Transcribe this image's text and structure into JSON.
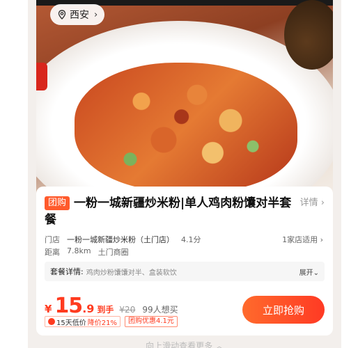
{
  "location": {
    "city": "西安",
    "pin_icon": "location-pin-icon",
    "chevron_icon": "chevron-right-icon"
  },
  "deal": {
    "tag": "团购",
    "title": "一粉一城新疆炒米粉|单人鸡肉粉馕对半套餐",
    "detail_link": "详情 ›",
    "store_label": "门店",
    "store_name": "一粉一城新疆炒米粉（土门店）",
    "rating": "4.1分",
    "stores_applicable": "1家店适用 ›",
    "distance_label": "距离",
    "distance": "7.8km",
    "area": "土门商圈",
    "package_label": "套餐详情:",
    "package_value": "鸡肉炒粉馕馕对半、盒装软饮",
    "expand_label": "展开⌄"
  },
  "pricing": {
    "currency": "¥",
    "price_int": "15",
    "price_dec": ".9",
    "arrive_label": "到手",
    "original": "¥20",
    "want_count": "99人想买",
    "badge_low": "15天低价",
    "badge_drop": "降价21%",
    "badge_discount": "团购优惠4.1元",
    "accent_color": "#ff3b1f"
  },
  "actions": {
    "buy_label": "立即抢购"
  },
  "footer": {
    "hint": "向上滑动查看更多 ︿"
  }
}
